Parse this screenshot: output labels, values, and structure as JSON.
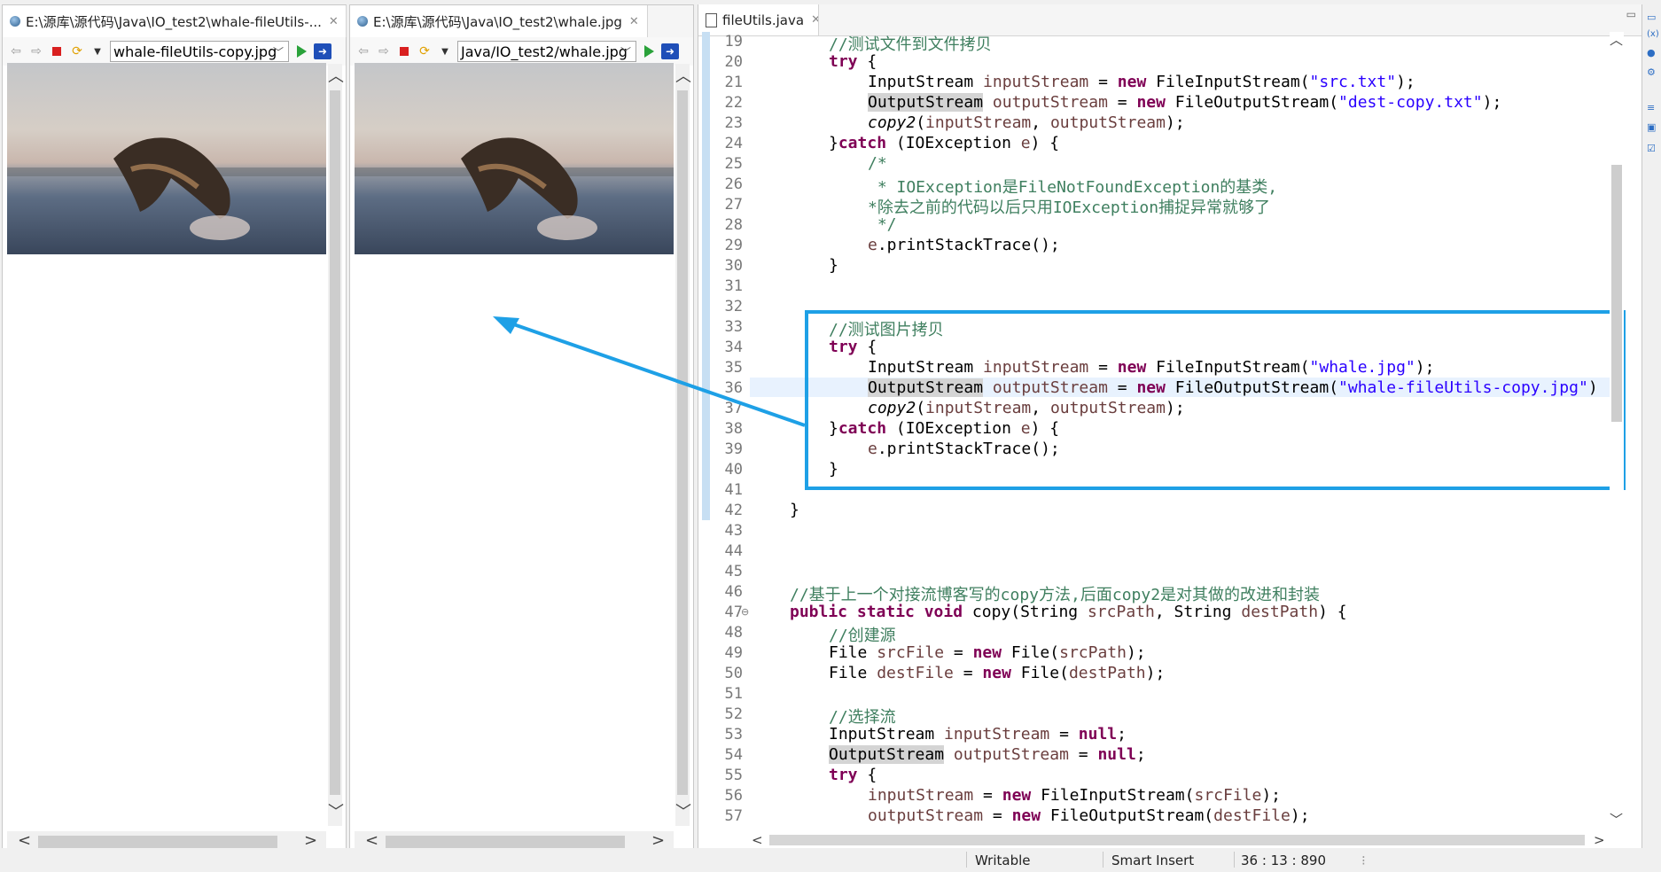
{
  "browser1": {
    "tab_title": "E:\\源库\\源代码\\Java\\IO_test2\\whale-fileUtils-...",
    "url": "whale-fileUtils-copy.jpg"
  },
  "browser2": {
    "tab_title": "E:\\源库\\源代码\\Java\\IO_test2\\whale.jpg",
    "url": "Java/IO_test2/whale.jpg"
  },
  "editor": {
    "tab_title": "fileUtils.java",
    "line_numbers": [
      "19",
      "20",
      "21",
      "22",
      "23",
      "24",
      "25",
      "26",
      "27",
      "28",
      "29",
      "30",
      "31",
      "32",
      "33",
      "34",
      "35",
      "36",
      "37",
      "38",
      "39",
      "40",
      "41",
      "42",
      "43",
      "44",
      "45",
      "46",
      "47",
      "48",
      "49",
      "50",
      "51",
      "52",
      "53",
      "54",
      "55",
      "56",
      "57"
    ],
    "lines": {
      "l19": "//测试文件到文件拷贝",
      "l20_kw": "try",
      "l20_rest": " {",
      "l21_a": "InputStream ",
      "l21_var": "inputStream",
      "l21_b": " = ",
      "l21_kw": "new",
      "l21_c": " FileInputStream(",
      "l21_str": "\"src.txt\"",
      "l21_d": ");",
      "l22_occ": "OutputStream",
      "l22_b": " ",
      "l22_var": "outputStream",
      "l22_c": " = ",
      "l22_kw": "new",
      "l22_d": " FileOutputStream(",
      "l22_str": "\"dest-copy.txt\"",
      "l22_e": ");",
      "l23_it": "copy2",
      "l23_a": "(",
      "l23_var1": "inputStream",
      "l23_b": ", ",
      "l23_var2": "outputStream",
      "l23_c": ");",
      "l24_a": "}",
      "l24_kw": "catch",
      "l24_b": " (IOException ",
      "l24_var": "e",
      "l24_c": ") {",
      "l25": "/*",
      "l26": " * IOException是FileNotFoundException的基类,",
      "l27": "*除去之前的代码以后只用IOException捕捉异常就够了",
      "l28": " */",
      "l29_var": "e",
      "l29_rest": ".printStackTrace();",
      "l30": "}",
      "l33": "//测试图片拷贝",
      "l34_kw": "try",
      "l34_rest": " {",
      "l35_a": "InputStream ",
      "l35_var": "inputStream",
      "l35_b": " = ",
      "l35_kw": "new",
      "l35_c": " FileInputStream(",
      "l35_str": "\"whale.jpg\"",
      "l35_d": ");",
      "l36_occ": "OutputStream",
      "l36_b": " ",
      "l36_var": "outputStream",
      "l36_c": " = ",
      "l36_kw": "new",
      "l36_d": " FileOutputStream(",
      "l36_str": "\"whale-fileUtils-copy.jpg\"",
      "l36_e": ")",
      "l37_it": "copy2",
      "l37_a": "(",
      "l37_var1": "inputStream",
      "l37_b": ", ",
      "l37_var2": "outputStream",
      "l37_c": ");",
      "l38_a": "}",
      "l38_kw": "catch",
      "l38_b": " (IOException ",
      "l38_var": "e",
      "l38_c": ") {",
      "l39_var": "e",
      "l39_rest": ".printStackTrace();",
      "l40": "}",
      "l42": "}",
      "l46": "//基于上一个对接流博客写的copy方法,后面copy2是对其做的改进和封装",
      "l47_kw": "public static void",
      "l47_a": " copy(String ",
      "l47_var1": "srcPath",
      "l47_b": ", String ",
      "l47_var2": "destPath",
      "l47_c": ") {",
      "l48": "//创建源",
      "l49_a": "File ",
      "l49_var": "srcFile",
      "l49_b": " = ",
      "l49_kw": "new",
      "l49_c": " File(",
      "l49_var2": "srcPath",
      "l49_d": ");",
      "l50_a": "File ",
      "l50_var": "destFile",
      "l50_b": " = ",
      "l50_kw": "new",
      "l50_c": " File(",
      "l50_var2": "destPath",
      "l50_d": ");",
      "l52": "//选择流",
      "l53_a": "InputStream ",
      "l53_var": "inputStream",
      "l53_b": " = ",
      "l53_kw": "null",
      "l53_c": ";",
      "l54_occ": "OutputStream",
      "l54_b": " ",
      "l54_var": "outputStream",
      "l54_c": " = ",
      "l54_kw": "null",
      "l54_d": ";",
      "l55_kw": "try",
      "l55_rest": " {",
      "l56_var": "inputStream",
      "l56_a": " = ",
      "l56_kw": "new",
      "l56_b": " FileInputStream(",
      "l56_var2": "srcFile",
      "l56_c": ");",
      "l57_var": "outputStream",
      "l57_a": " = ",
      "l57_kw": "new",
      "l57_b": " FileOutputStream(",
      "l57_var2": "destFile",
      "l57_c": ");"
    }
  },
  "status": {
    "writable": "Writable",
    "insert_mode": "Smart Insert",
    "position": "36 : 13 : 890"
  },
  "colors": {
    "keyword": "#7f0055",
    "string": "#2a00ff",
    "comment": "#3f7f5f",
    "variable": "#6a3e3e",
    "highlight": "#1ea0e6"
  }
}
